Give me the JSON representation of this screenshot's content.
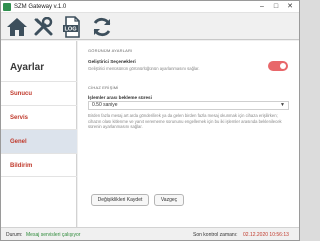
{
  "window": {
    "title": "SZM Gateway v.1.0"
  },
  "toolbar": {
    "items": [
      {
        "icon": "home-icon"
      },
      {
        "icon": "settings-tools-icon"
      },
      {
        "icon": "log-document-icon",
        "label": "LOG"
      },
      {
        "icon": "refresh-icon"
      }
    ]
  },
  "sidebar": {
    "title": "Ayarlar",
    "items": [
      {
        "label": "Sunucu"
      },
      {
        "label": "Servis"
      },
      {
        "label": "Genel"
      },
      {
        "label": "Bildirim"
      }
    ],
    "active_item": "Genel"
  },
  "content": {
    "section1": {
      "title": "GÖRÜNÜM AYARLARI",
      "dev_label": "Geliştirici Seçenekleri",
      "dev_desc": "Geliştirici menüsünün görünürlüğünün ayarlanmasını sağlar.",
      "dev_enabled": false
    },
    "section2": {
      "title": "CİHAZ ERİŞİMİ",
      "wait_label": "İşlemler arası bekleme süresi",
      "wait_value": "0.50 saniye",
      "wait_desc": "Birden fazla mesaj art arda gönderilirek ya da gelen birden fazla mesaj okunmak için cihaza erişilirken; cihazın olası kitlenme ve yanıt verememe sorununu engellemek için bu iki işlemler arasında beklenilecek sürenin ayarlanmasını sağlar."
    },
    "buttons": {
      "save": "Değişiklikleri Kaydet",
      "cancel": "Vazgeç"
    }
  },
  "status": {
    "label": "Durum:",
    "value": "Mesaj servisleri çalışıyor",
    "last_check_label": "Son kontrol zamanı:",
    "last_check_value": "02.12.2020 10:56:13"
  },
  "colors": {
    "accent": "#c0392b",
    "status_ok": "#2e8b3a",
    "toggle_off": "#e8676a",
    "active_bg": "#dce3ec"
  }
}
